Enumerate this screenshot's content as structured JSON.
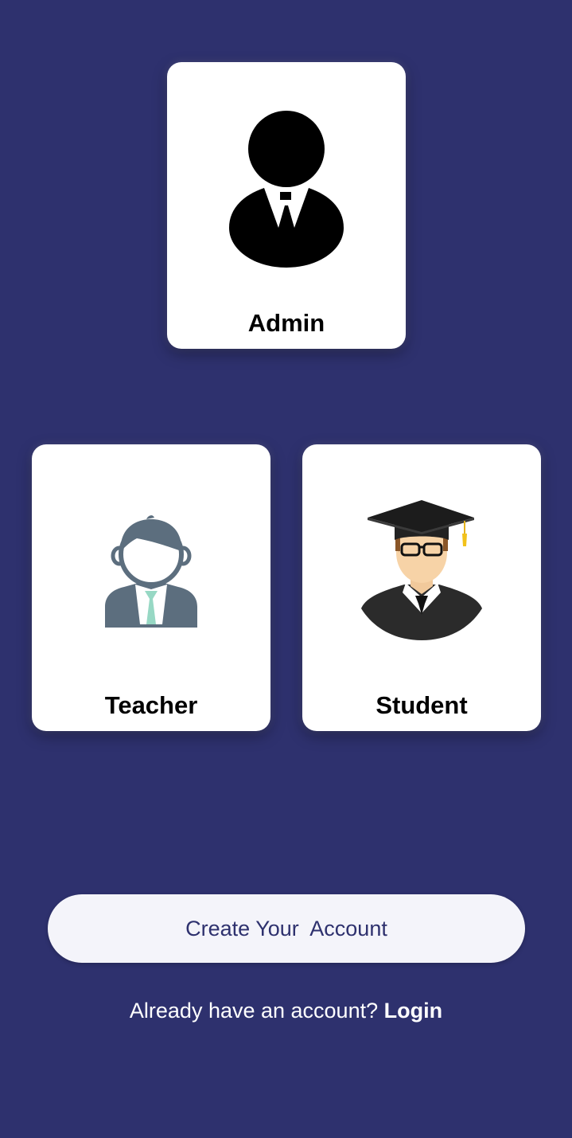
{
  "colors": {
    "background": "#2e316e",
    "card": "#ffffff",
    "button_bg": "#f4f4fa",
    "button_text": "#2e316e"
  },
  "roles": {
    "admin": {
      "label": "Admin",
      "icon": "admin-person-icon"
    },
    "teacher": {
      "label": "Teacher",
      "icon": "teacher-avatar-icon"
    },
    "student": {
      "label": "Student",
      "icon": "student-graduate-icon"
    }
  },
  "actions": {
    "create_account_label": "Create Your  Account",
    "login_prompt": "Already have an account?",
    "login_label": "Login"
  }
}
